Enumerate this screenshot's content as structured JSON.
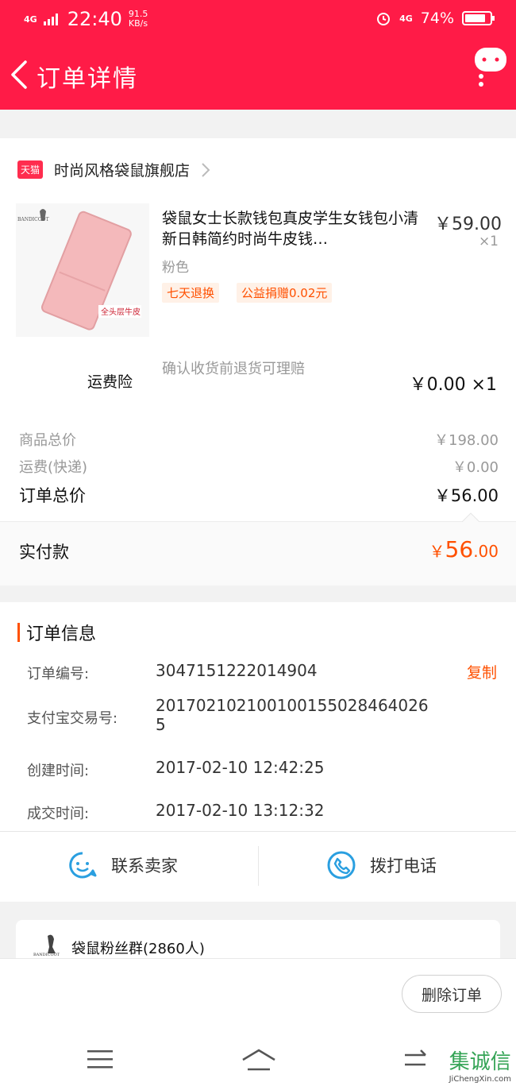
{
  "status_bar": {
    "network": "4G",
    "time": "22:40",
    "speed_value": "91.5",
    "speed_unit": "KB/s",
    "network_right": "4G",
    "battery": "74%",
    "battery_level": 0.74
  },
  "header": {
    "title": "订单详情"
  },
  "shop": {
    "badge": "天猫",
    "name": "时尚风格袋鼠旗舰店"
  },
  "product": {
    "title": "袋鼠女士长款钱包真皮学生女钱包小清新日韩简约时尚牛皮钱…",
    "price": "￥59.00",
    "qty": "×1",
    "sku": "粉色",
    "tags": [
      "七天退换",
      "公益捐赠0.02元"
    ],
    "image_label": "全头层牛皮"
  },
  "insurance": {
    "label": "运费险",
    "desc": "确认收货前退货可理赔",
    "price": "￥0.00 ×1"
  },
  "summary": {
    "goods_total_label": "商品总价",
    "goods_total": "￥198.00",
    "shipping_label": "运费(快递)",
    "shipping": "￥0.00",
    "order_total_label": "订单总价",
    "order_total": "￥56.00",
    "paid_label": "实付款",
    "paid_currency": "￥",
    "paid_int": "56",
    "paid_dec": ".00"
  },
  "order_info": {
    "title": "订单信息",
    "order_no_label": "订单编号:",
    "order_no": "3047151222014904",
    "copy_label": "复制",
    "alipay_label": "支付宝交易号:",
    "alipay_no": "2017021021001001550284640265",
    "created_label": "创建时间:",
    "created": "2017-02-10 12:42:25",
    "deal_label": "成交时间:",
    "deal": "2017-02-10 13:12:32"
  },
  "actions": {
    "contact": "联系卖家",
    "call": "拨打电话"
  },
  "group": {
    "name": "袋鼠粉丝群(2860人)"
  },
  "bottom": {
    "delete": "删除订单"
  },
  "watermark": {
    "text": "集诚信",
    "url": "JiChengXin.com"
  },
  "colors": {
    "brand": "#ff1b47",
    "accent": "#ff5000",
    "link_blue": "#2a9fe0"
  }
}
